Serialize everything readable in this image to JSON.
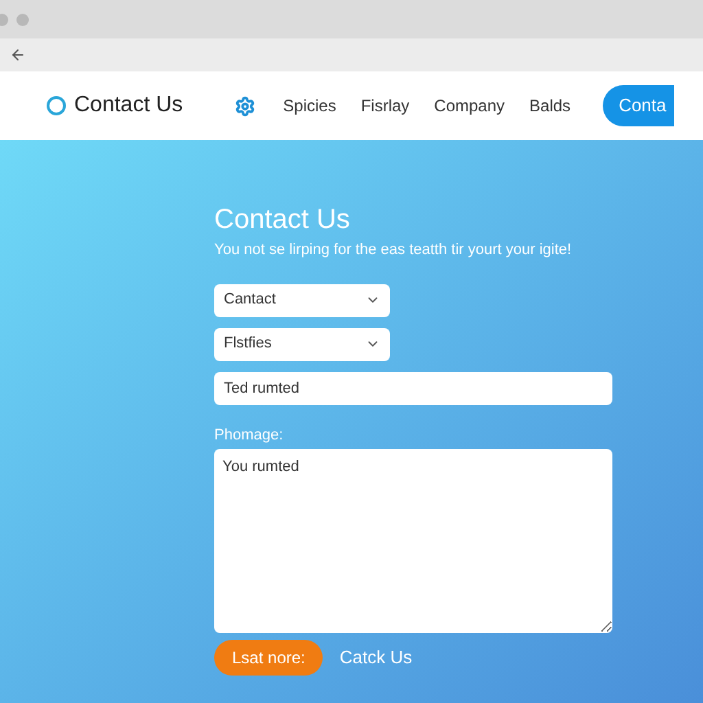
{
  "nav": {
    "brand": "Contact Us",
    "links": [
      "Spicies",
      "Fisrlay",
      "Company",
      "Balds"
    ],
    "cta": "Conta"
  },
  "form": {
    "title": "Contact Us",
    "subtitle": "You not se lirping for the eas teatth tir yourt your igite!",
    "selects": [
      {
        "value": "Cantact"
      },
      {
        "value": "Flstfies"
      }
    ],
    "input": {
      "value": "Ted rumted"
    },
    "message_label": "Phomage:",
    "message": {
      "value": "You rumted"
    },
    "submit": "Lsat nore:",
    "link": "Catck Us"
  }
}
